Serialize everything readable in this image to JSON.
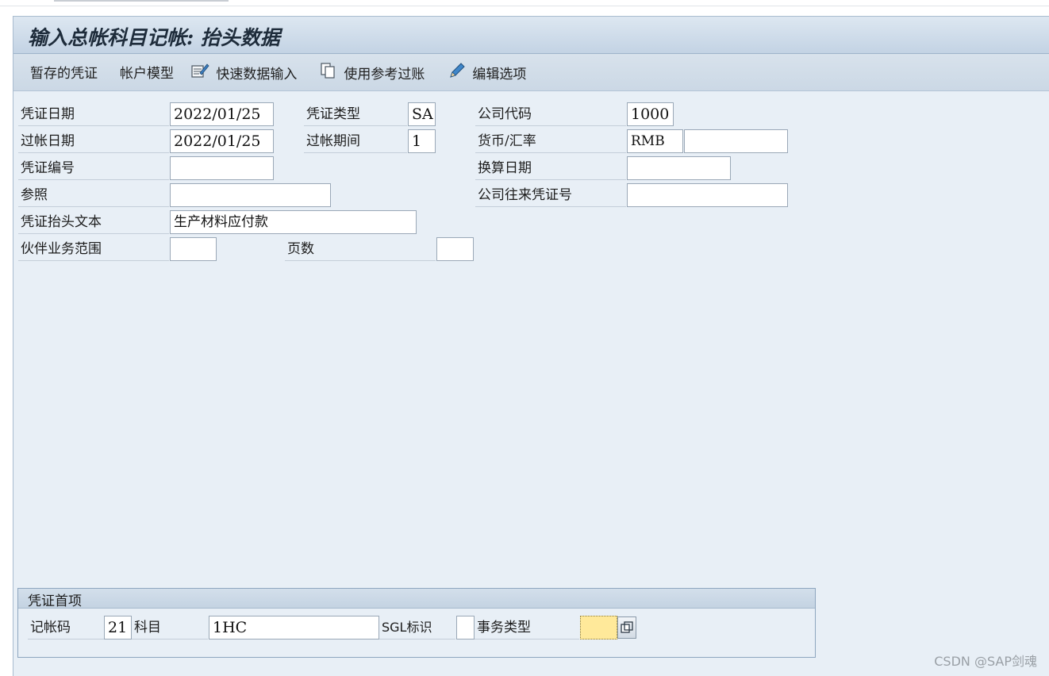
{
  "title": "输入总帐科目记帐: 抬头数据",
  "toolbar": {
    "items": [
      {
        "label": "暂存的凭证",
        "icon": "none"
      },
      {
        "label": "帐户模型",
        "icon": "none"
      },
      {
        "label": "快速数据输入",
        "icon": "fast-entry-icon"
      },
      {
        "label": "使用参考过账",
        "icon": "copy-reference-icon"
      },
      {
        "label": "编辑选项",
        "icon": "pencil-icon"
      }
    ]
  },
  "header": {
    "doc_date_label": "凭证日期",
    "doc_date_value": "2022/01/25",
    "doc_type_label": "凭证类型",
    "doc_type_value": "SA",
    "company_code_label": "公司代码",
    "company_code_value": "1000",
    "posting_date_label": "过帐日期",
    "posting_date_value": "2022/01/25",
    "period_label": "过帐期间",
    "period_value": "1",
    "currency_label": "货币/汇率",
    "currency_value": "RMB",
    "exchange_rate_value": "",
    "doc_number_label": "凭证编号",
    "doc_number_value": "",
    "translation_date_label": "换算日期",
    "translation_date_value": "",
    "reference_label": "参照",
    "reference_value": "",
    "intercompany_label": "公司往来凭证号",
    "intercompany_value": "",
    "header_text_label": "凭证抬头文本",
    "header_text_value": "生产材料应付款",
    "trading_partner_label": "伙伴业务范围",
    "trading_partner_value": "",
    "page_label": "页数",
    "page_value": ""
  },
  "first_item": {
    "title": "凭证首项",
    "posting_key_label": "记帐码",
    "posting_key_value": "21",
    "account_label": "科目",
    "account_value": "1HC",
    "sgl_label": "SGL标识",
    "sgl_value": "",
    "transaction_type_label": "事务类型",
    "transaction_type_value": ""
  },
  "watermark": "CSDN @SAP剑魂",
  "colors": {
    "background": "#e8eff6",
    "title_bar": "#c3d3e4",
    "highlight_field": "#ffe99a"
  }
}
